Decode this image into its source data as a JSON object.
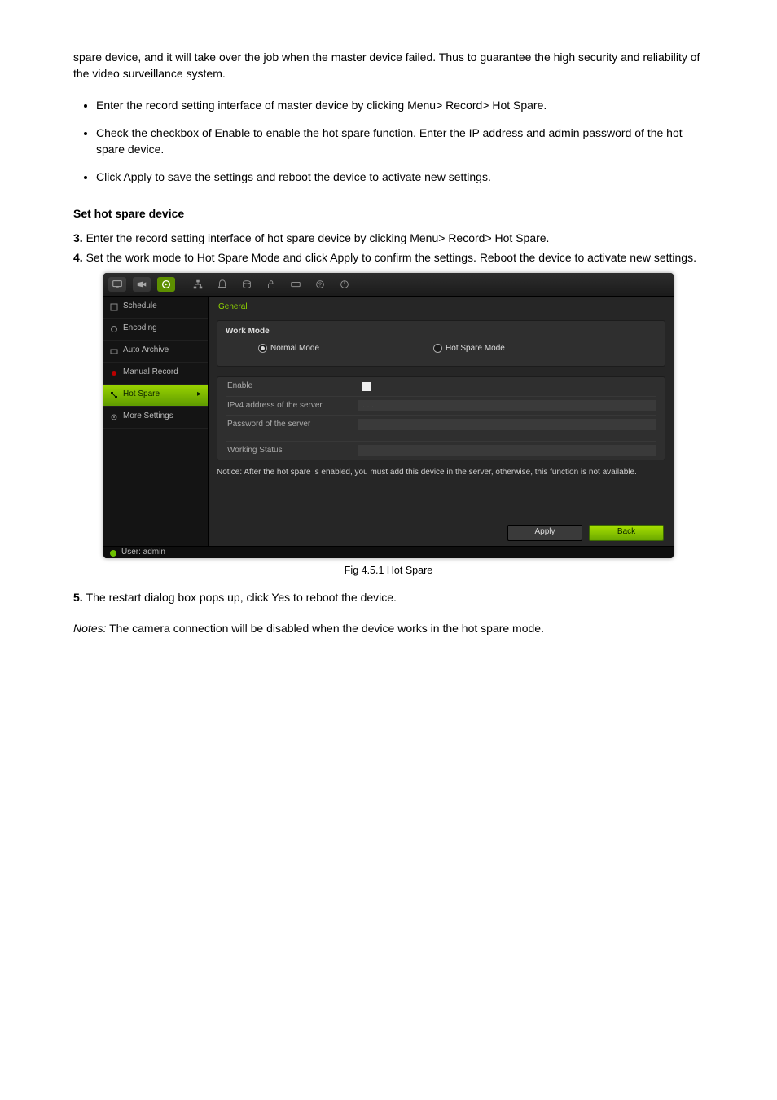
{
  "doc": {
    "intro": "spare device, and it will take over the job when the master device failed. Thus to guarantee the high security and reliability of the video surveillance system.",
    "bullets": [
      "Enter the record setting interface of master device by clicking Menu> Record> Hot Spare.",
      "Check the checkbox of Enable to enable the hot spare function. Enter the IP address and admin password of the hot spare device.",
      "Click Apply to save the settings and reboot the device to activate new settings."
    ],
    "section_heading": "Set hot spare device",
    "step3num": "3. ",
    "step3text": "Enter the record setting interface of hot spare device by clicking Menu> Record> Hot Spare.",
    "step4num": "4. ",
    "step4text": "Set the work mode to Hot Spare Mode and click Apply to confirm the settings. Reboot the device to activate new settings.",
    "step5num": "5. ",
    "step5text": "The restart dialog box pops up, click Yes to reboot the device.",
    "note_label": "Notes:",
    "note_text": "The camera connection will be disabled when the device works in the hot spare mode.",
    "fig_caption": "Fig 4.5.1 Hot Spare"
  },
  "ui": {
    "sidebar": {
      "items": [
        "Schedule",
        "Encoding",
        "Auto Archive",
        "Manual Record",
        "Hot Spare",
        "More Settings"
      ]
    },
    "tab": "General",
    "panel_title": "Work Mode",
    "mode_normal": "Normal Mode",
    "mode_hotspare": "Hot Spare Mode",
    "rows": {
      "enable": "Enable",
      "ipv4": "IPv4 address of the server",
      "ipv4_value": ". . .",
      "password": "Password of the server",
      "working": "Working Status"
    },
    "notice": "Notice: After the hot spare is enabled, you must add this device in the server, otherwise, this function is not available.",
    "apply": "Apply",
    "back": "Back",
    "status_user": "User: admin"
  }
}
